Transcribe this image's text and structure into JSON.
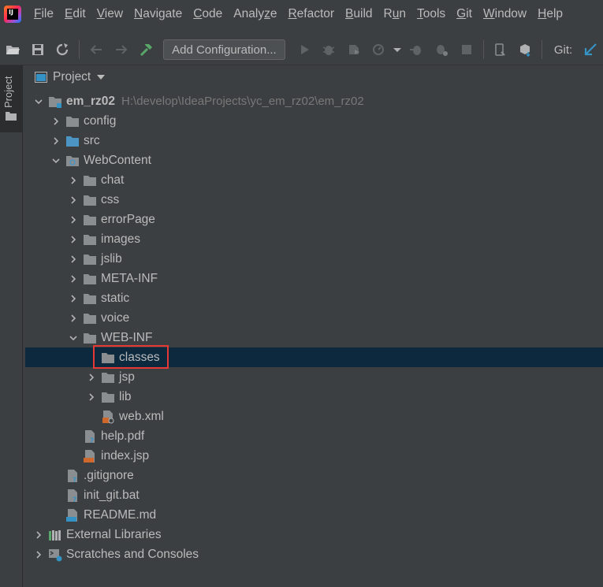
{
  "app": {
    "logo_text": "IJ"
  },
  "menubar": {
    "items": [
      {
        "prefix": "",
        "ul": "F",
        "rest": "ile"
      },
      {
        "prefix": "",
        "ul": "E",
        "rest": "dit"
      },
      {
        "prefix": "",
        "ul": "V",
        "rest": "iew"
      },
      {
        "prefix": "",
        "ul": "N",
        "rest": "avigate"
      },
      {
        "prefix": "",
        "ul": "C",
        "rest": "ode"
      },
      {
        "prefix": "Analy",
        "ul": "z",
        "rest": "e"
      },
      {
        "prefix": "",
        "ul": "R",
        "rest": "efactor"
      },
      {
        "prefix": "",
        "ul": "B",
        "rest": "uild"
      },
      {
        "prefix": "R",
        "ul": "u",
        "rest": "n"
      },
      {
        "prefix": "",
        "ul": "T",
        "rest": "ools"
      },
      {
        "prefix": "",
        "ul": "G",
        "rest": "it"
      },
      {
        "prefix": "",
        "ul": "W",
        "rest": "indow"
      },
      {
        "prefix": "",
        "ul": "H",
        "rest": "elp"
      }
    ]
  },
  "toolbar": {
    "config_label": "Add Configuration...",
    "git_label": "Git:"
  },
  "toolwindow": {
    "tab_label": "Project"
  },
  "panel": {
    "title": "Project"
  },
  "tree": {
    "root_name": "em_rz02",
    "root_path": "H:\\develop\\IdeaProjects\\yc_em_rz02\\em_rz02",
    "config": "config",
    "src": "src",
    "webcontent": "WebContent",
    "chat": "chat",
    "css": "css",
    "errorpage": "errorPage",
    "images": "images",
    "jslib": "jslib",
    "metainf": "META-INF",
    "static": "static",
    "voice": "voice",
    "webinf": "WEB-INF",
    "classes": "classes",
    "jsp": "jsp",
    "lib": "lib",
    "webxml": "web.xml",
    "helppdf": "help.pdf",
    "indexjsp": "index.jsp",
    "gitignore": ".gitignore",
    "initgit": "init_git.bat",
    "readme": "README.md",
    "extlibs": "External Libraries",
    "scratches": "Scratches and Consoles"
  },
  "colors": {
    "background": "#3c3f41",
    "selection": "#0d293e",
    "folder": "#8a8e91",
    "source_folder": "#4c94c4",
    "highlight": "#e53935"
  }
}
